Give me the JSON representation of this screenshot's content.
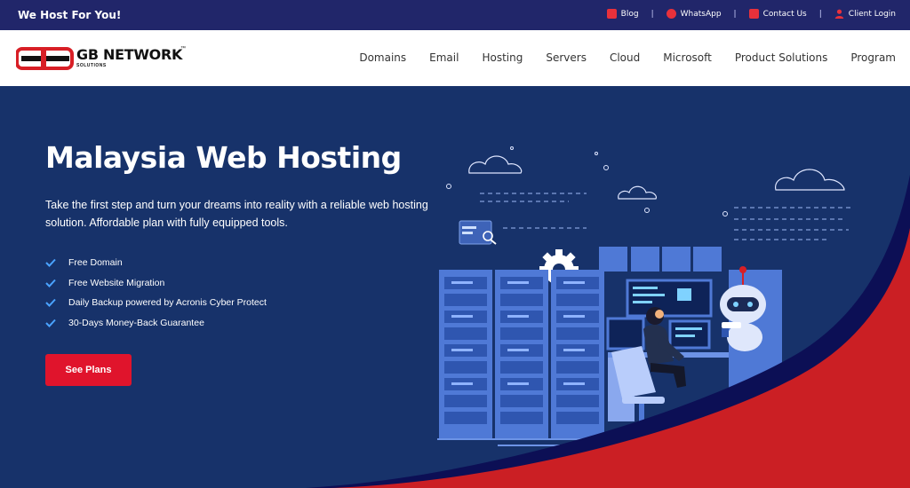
{
  "topbar": {
    "tagline": "We Host For You!",
    "links": [
      {
        "label": "Blog",
        "icon": "blog-icon"
      },
      {
        "label": "WhatsApp",
        "icon": "whatsapp-icon"
      },
      {
        "label": "Contact Us",
        "icon": "mail-icon"
      },
      {
        "label": "Client Login",
        "icon": "user-icon"
      }
    ],
    "separator": "|"
  },
  "logo": {
    "letters": "GB",
    "name": "GB NETWORK",
    "tm": "™",
    "sub": "SOLUTIONS"
  },
  "nav": {
    "items": [
      "Domains",
      "Email",
      "Hosting",
      "Servers",
      "Cloud",
      "Microsoft",
      "Product Solutions",
      "Program"
    ]
  },
  "hero": {
    "title": "Malaysia Web Hosting",
    "description": "Take the first step and turn your dreams into reality with a reliable web hosting solution. Affordable plan with fully equipped tools.",
    "features": [
      "Free Domain",
      "Free Website Migration",
      "Daily Backup powered by Acronis Cyber Protect",
      "30-Days Money-Back Guarantee"
    ],
    "cta": "See Plans"
  },
  "colors": {
    "topbar": "#21266a",
    "hero_bg": "#17326a",
    "accent_red": "#e0142c",
    "wave_red": "#cb1f24",
    "wave_navy": "#0c0f55",
    "check_blue": "#4aa3ff"
  }
}
